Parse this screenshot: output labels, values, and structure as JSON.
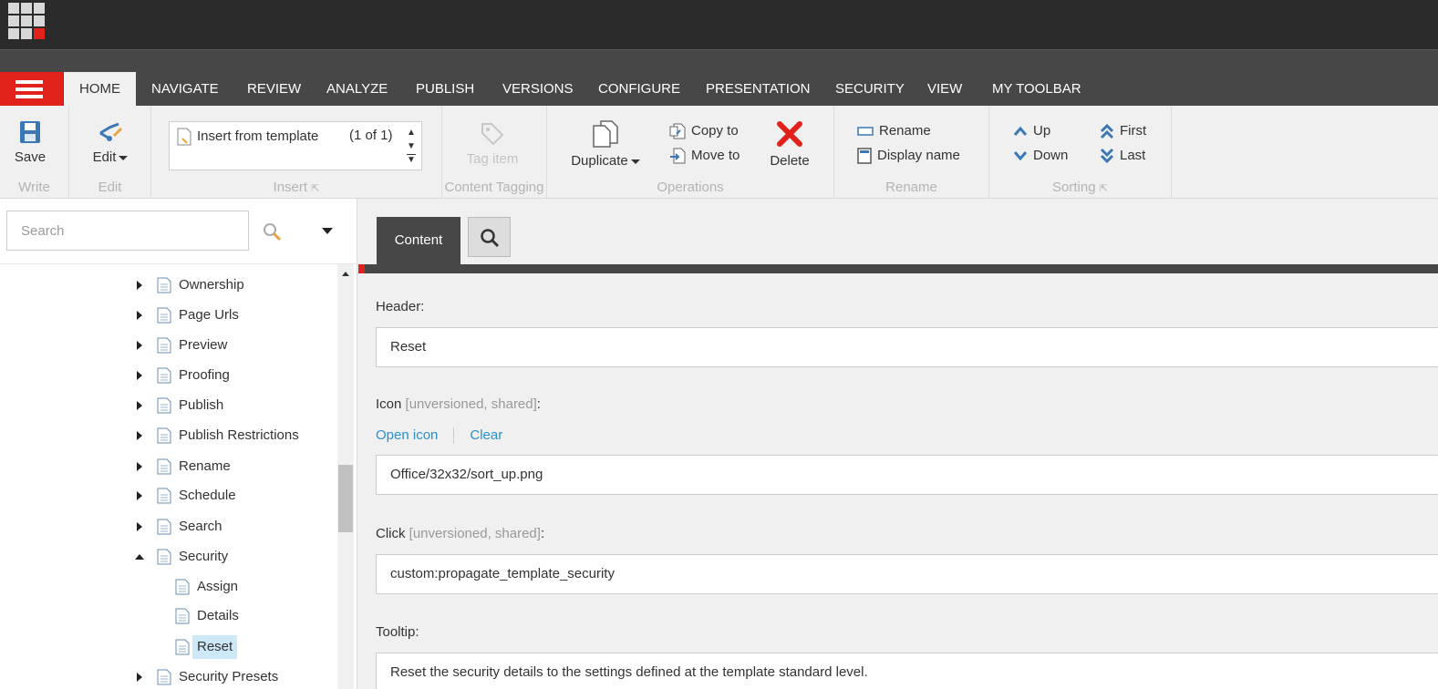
{
  "topbar": {
    "launchpad_icon": "launchpad-grid-icon"
  },
  "ribbon_tabs": [
    "HOME",
    "NAVIGATE",
    "REVIEW",
    "ANALYZE",
    "PUBLISH",
    "VERSIONS",
    "CONFIGURE",
    "PRESENTATION",
    "SECURITY",
    "VIEW",
    "MY TOOLBAR"
  ],
  "active_tab": "HOME",
  "ribbon": {
    "write": {
      "label": "Write",
      "save": "Save"
    },
    "edit": {
      "label": "Edit",
      "edit": "Edit"
    },
    "insert": {
      "label": "Insert",
      "item": "Insert from template",
      "count": "(1 of 1)"
    },
    "tagging": {
      "label": "Content Tagging",
      "tag_item": "Tag item"
    },
    "operations": {
      "label": "Operations",
      "duplicate": "Duplicate",
      "copy_to": "Copy to",
      "move_to": "Move to",
      "delete": "Delete"
    },
    "rename": {
      "label": "Rename",
      "rename": "Rename",
      "display_name": "Display name"
    },
    "sorting": {
      "label": "Sorting",
      "up": "Up",
      "down": "Down",
      "first": "First",
      "last": "Last"
    }
  },
  "tree": {
    "search_placeholder": "Search",
    "items": [
      {
        "label": "Ownership",
        "level": 0,
        "expander": "closed"
      },
      {
        "label": "Page Urls",
        "level": 0,
        "expander": "closed"
      },
      {
        "label": "Preview",
        "level": 0,
        "expander": "closed"
      },
      {
        "label": "Proofing",
        "level": 0,
        "expander": "closed"
      },
      {
        "label": "Publish",
        "level": 0,
        "expander": "closed"
      },
      {
        "label": "Publish Restrictions",
        "level": 0,
        "expander": "closed"
      },
      {
        "label": "Rename",
        "level": 0,
        "expander": "closed"
      },
      {
        "label": "Schedule",
        "level": 0,
        "expander": "closed"
      },
      {
        "label": "Search",
        "level": 0,
        "expander": "closed"
      },
      {
        "label": "Security",
        "level": 0,
        "expander": "open"
      },
      {
        "label": "Assign",
        "level": 1,
        "expander": "none"
      },
      {
        "label": "Details",
        "level": 1,
        "expander": "none"
      },
      {
        "label": "Reset",
        "level": 1,
        "expander": "none",
        "selected": true
      },
      {
        "label": "Security Presets",
        "level": 0,
        "expander": "closed"
      }
    ]
  },
  "editor": {
    "tab_content": "Content",
    "fields": {
      "header": {
        "label": "Header:",
        "value": "Reset"
      },
      "icon": {
        "label": "Icon",
        "meta": "[unversioned, shared]",
        "colon": ":",
        "value": "Office/32x32/sort_up.png",
        "open_link": "Open icon",
        "clear_link": "Clear"
      },
      "click": {
        "label": "Click",
        "meta": "[unversioned, shared]",
        "colon": ":",
        "value": "custom:propagate_template_security"
      },
      "tooltip": {
        "label": "Tooltip:",
        "value": "Reset the security details to the settings defined at the template standard level."
      }
    }
  },
  "colors": {
    "accent_red": "#e0221b",
    "dark_bar": "#474747",
    "link_blue": "#2a8fcc",
    "selected_row": "#cde8f6"
  }
}
